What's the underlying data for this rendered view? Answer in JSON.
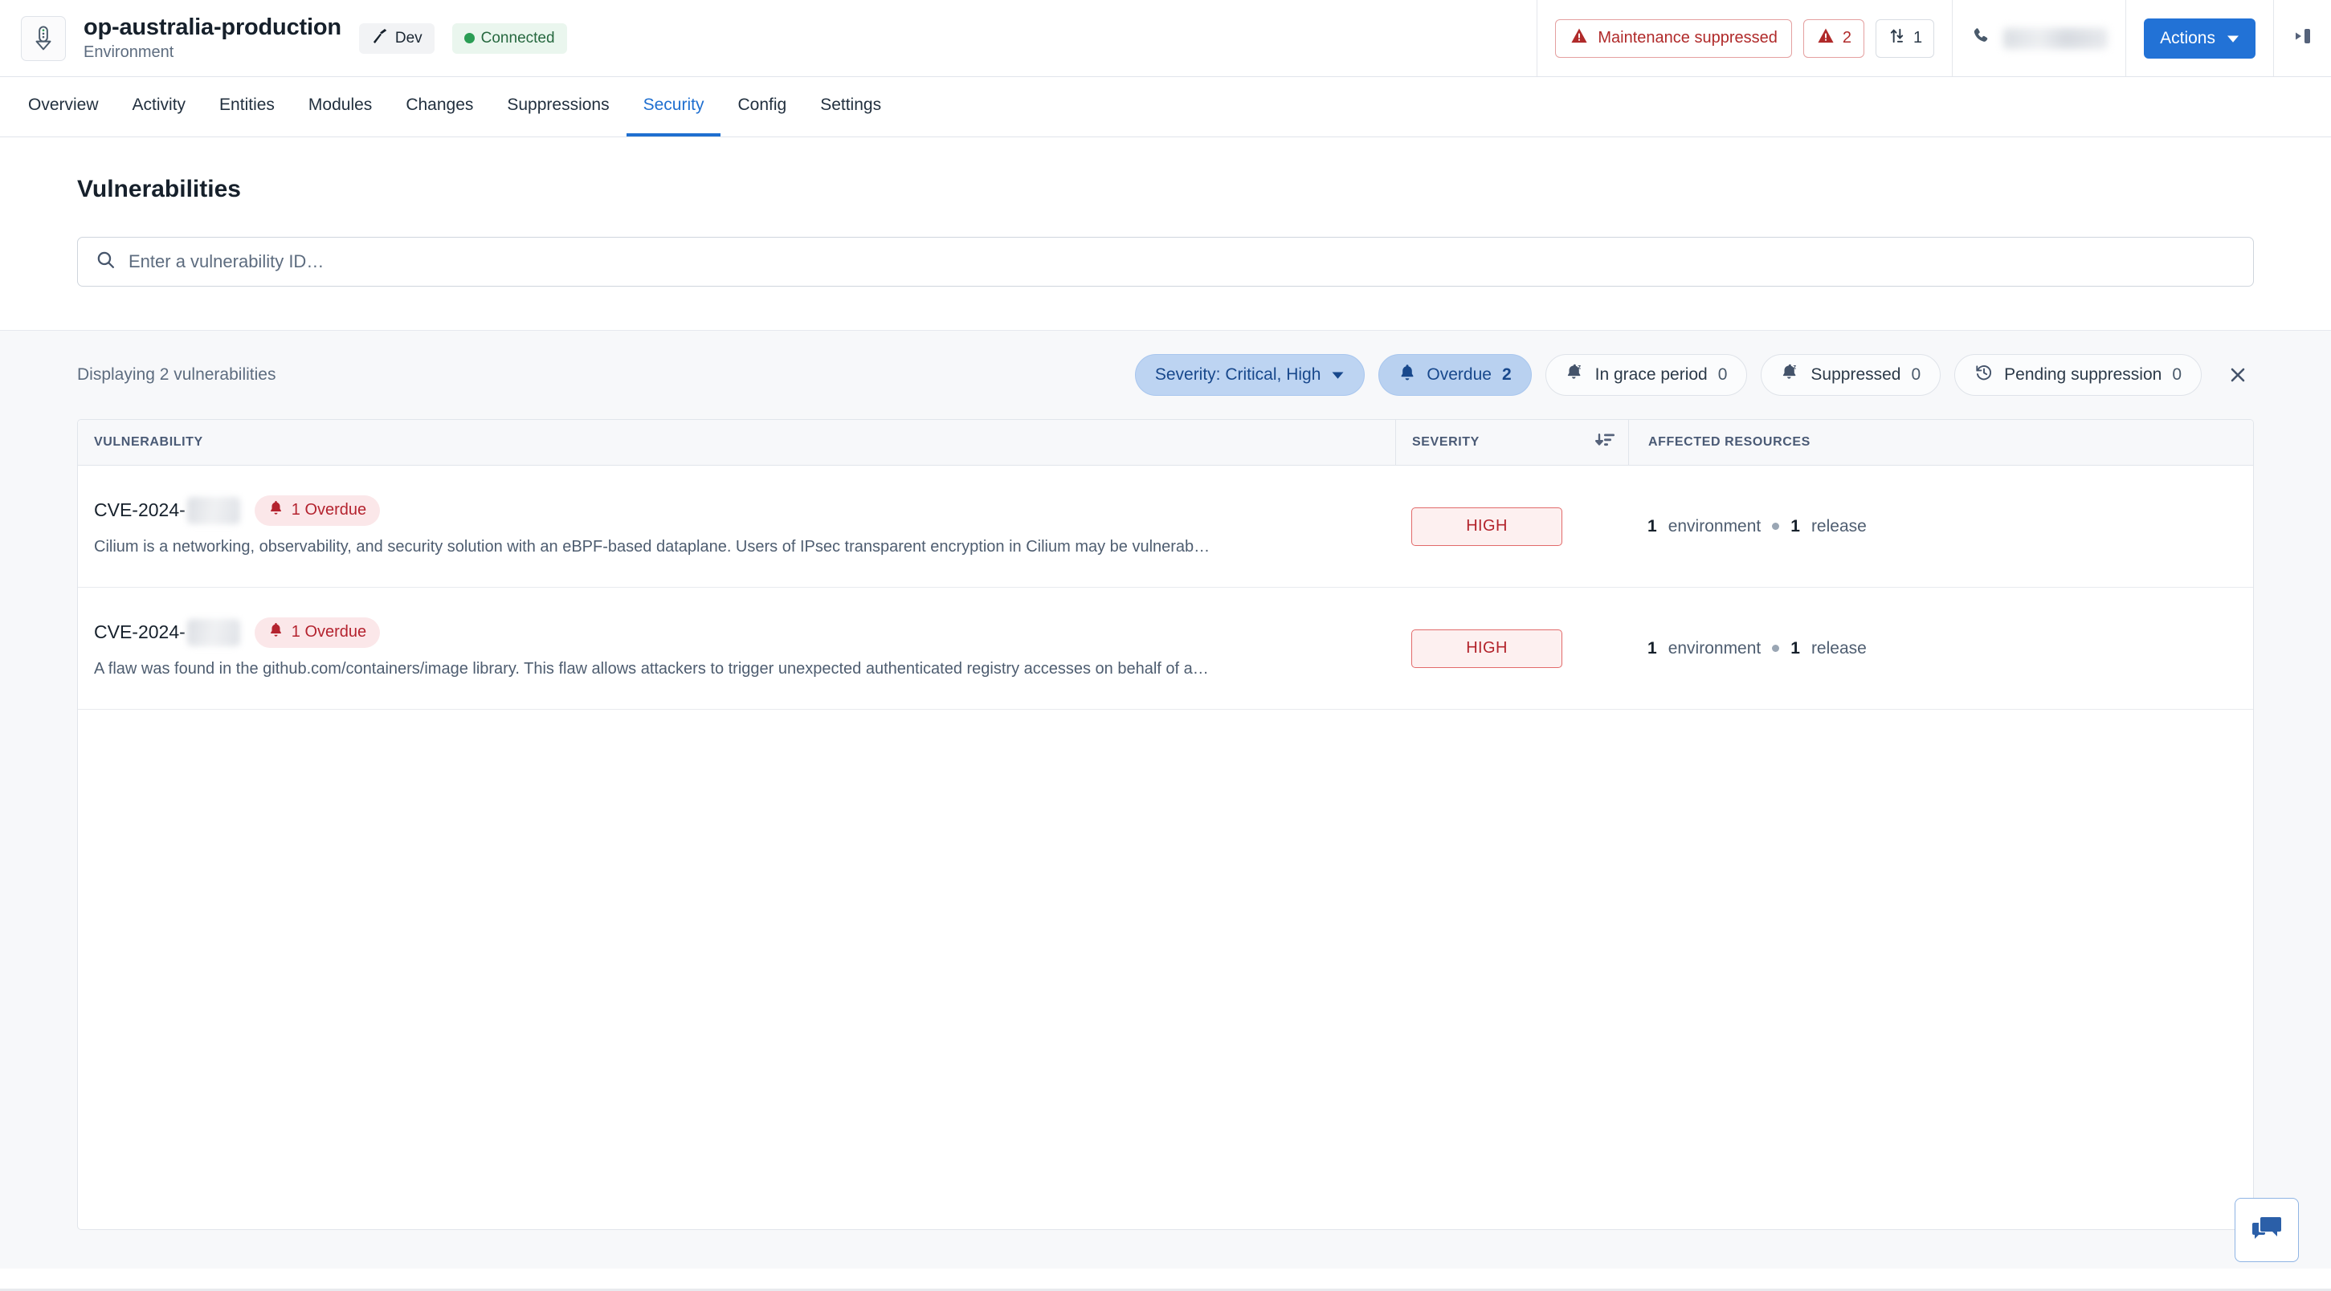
{
  "header": {
    "env_icon": "environment-icon",
    "title": "op-australia-production",
    "subtitle": "Environment",
    "stage_tag": {
      "icon": "hammer-icon",
      "label": "Dev"
    },
    "connection_tag": {
      "icon": "status-dot-green",
      "label": "Connected"
    },
    "maintenance_button": {
      "icon": "warning-triangle-icon",
      "label": "Maintenance suppressed"
    },
    "alerts_button": {
      "icon": "warning-triangle-icon",
      "label": "2"
    },
    "drift_button": {
      "icon": "sync-arrows-icon",
      "label": "1"
    },
    "phone_icon": "phone-icon",
    "phone_value_redacted": "",
    "actions_button": {
      "label": "Actions",
      "caret": "chevron-down-icon"
    },
    "collapse_button": "panel-collapse-icon",
    "accent_color": "#2272d6",
    "danger_color": "#b02a2a"
  },
  "nav": {
    "tabs": [
      {
        "label": "Overview",
        "active": false
      },
      {
        "label": "Activity",
        "active": false
      },
      {
        "label": "Entities",
        "active": false
      },
      {
        "label": "Modules",
        "active": false
      },
      {
        "label": "Changes",
        "active": false
      },
      {
        "label": "Suppressions",
        "active": false
      },
      {
        "label": "Security",
        "active": true
      },
      {
        "label": "Config",
        "active": false
      },
      {
        "label": "Settings",
        "active": false
      }
    ]
  },
  "search": {
    "title": "Vulnerabilities",
    "icon": "search-icon",
    "placeholder": "Enter a vulnerability ID…",
    "value": ""
  },
  "results": {
    "displaying_text": "Displaying 2 vulnerabilities",
    "chips": [
      {
        "id": "severity",
        "icon": null,
        "label": "Severity: Critical, High",
        "count": null,
        "caret": "▼",
        "selected": true
      },
      {
        "id": "overdue",
        "icon": "bell-icon",
        "label": "Overdue",
        "count": "2",
        "caret": null,
        "selected": true
      },
      {
        "id": "grace",
        "icon": "bell-snooze-icon",
        "label": "In grace period",
        "count": "0",
        "caret": null,
        "selected": false
      },
      {
        "id": "suppressed",
        "icon": "bell-snooze-icon",
        "label": "Suppressed",
        "count": "0",
        "caret": null,
        "selected": false
      },
      {
        "id": "pending",
        "icon": "clock-history-icon",
        "label": "Pending suppression",
        "count": "0",
        "caret": null,
        "selected": false
      }
    ],
    "clear_filters_icon": "close-icon",
    "chip_selected_bg": "#bdd4f2",
    "chip_selected_text": "#18488c"
  },
  "table": {
    "columns": [
      {
        "key": "vulnerability",
        "label": "Vulnerability"
      },
      {
        "key": "severity",
        "label": "Severity",
        "sort_icon": "sort-descending-icon"
      },
      {
        "key": "affected_resources",
        "label": "Affected resources"
      }
    ],
    "rows": [
      {
        "cve_prefix": "CVE-2024-",
        "cve_suffix_redacted": true,
        "overdue_badge": {
          "icon": "bell-icon",
          "label": "1 Overdue"
        },
        "description": "Cilium is a networking, observability, and security solution with an eBPF-based dataplane. Users of IPsec transparent encryption in Cilium may be vulnerab…",
        "severity": "HIGH",
        "severity_color": "#b3242c",
        "affected": {
          "env_count": "1",
          "env_word": "environment",
          "release_count": "1",
          "release_word": "release"
        }
      },
      {
        "cve_prefix": "CVE-2024-",
        "cve_suffix_redacted": true,
        "overdue_badge": {
          "icon": "bell-icon",
          "label": "1 Overdue"
        },
        "description": "A flaw was found in the github.com/containers/image library. This flaw allows attackers to trigger unexpected authenticated registry accesses on behalf of a…",
        "severity": "HIGH",
        "severity_color": "#b3242c",
        "affected": {
          "env_count": "1",
          "env_word": "environment",
          "release_count": "1",
          "release_word": "release"
        }
      }
    ]
  },
  "chat_fab": {
    "icon": "chat-bubbles-icon"
  }
}
